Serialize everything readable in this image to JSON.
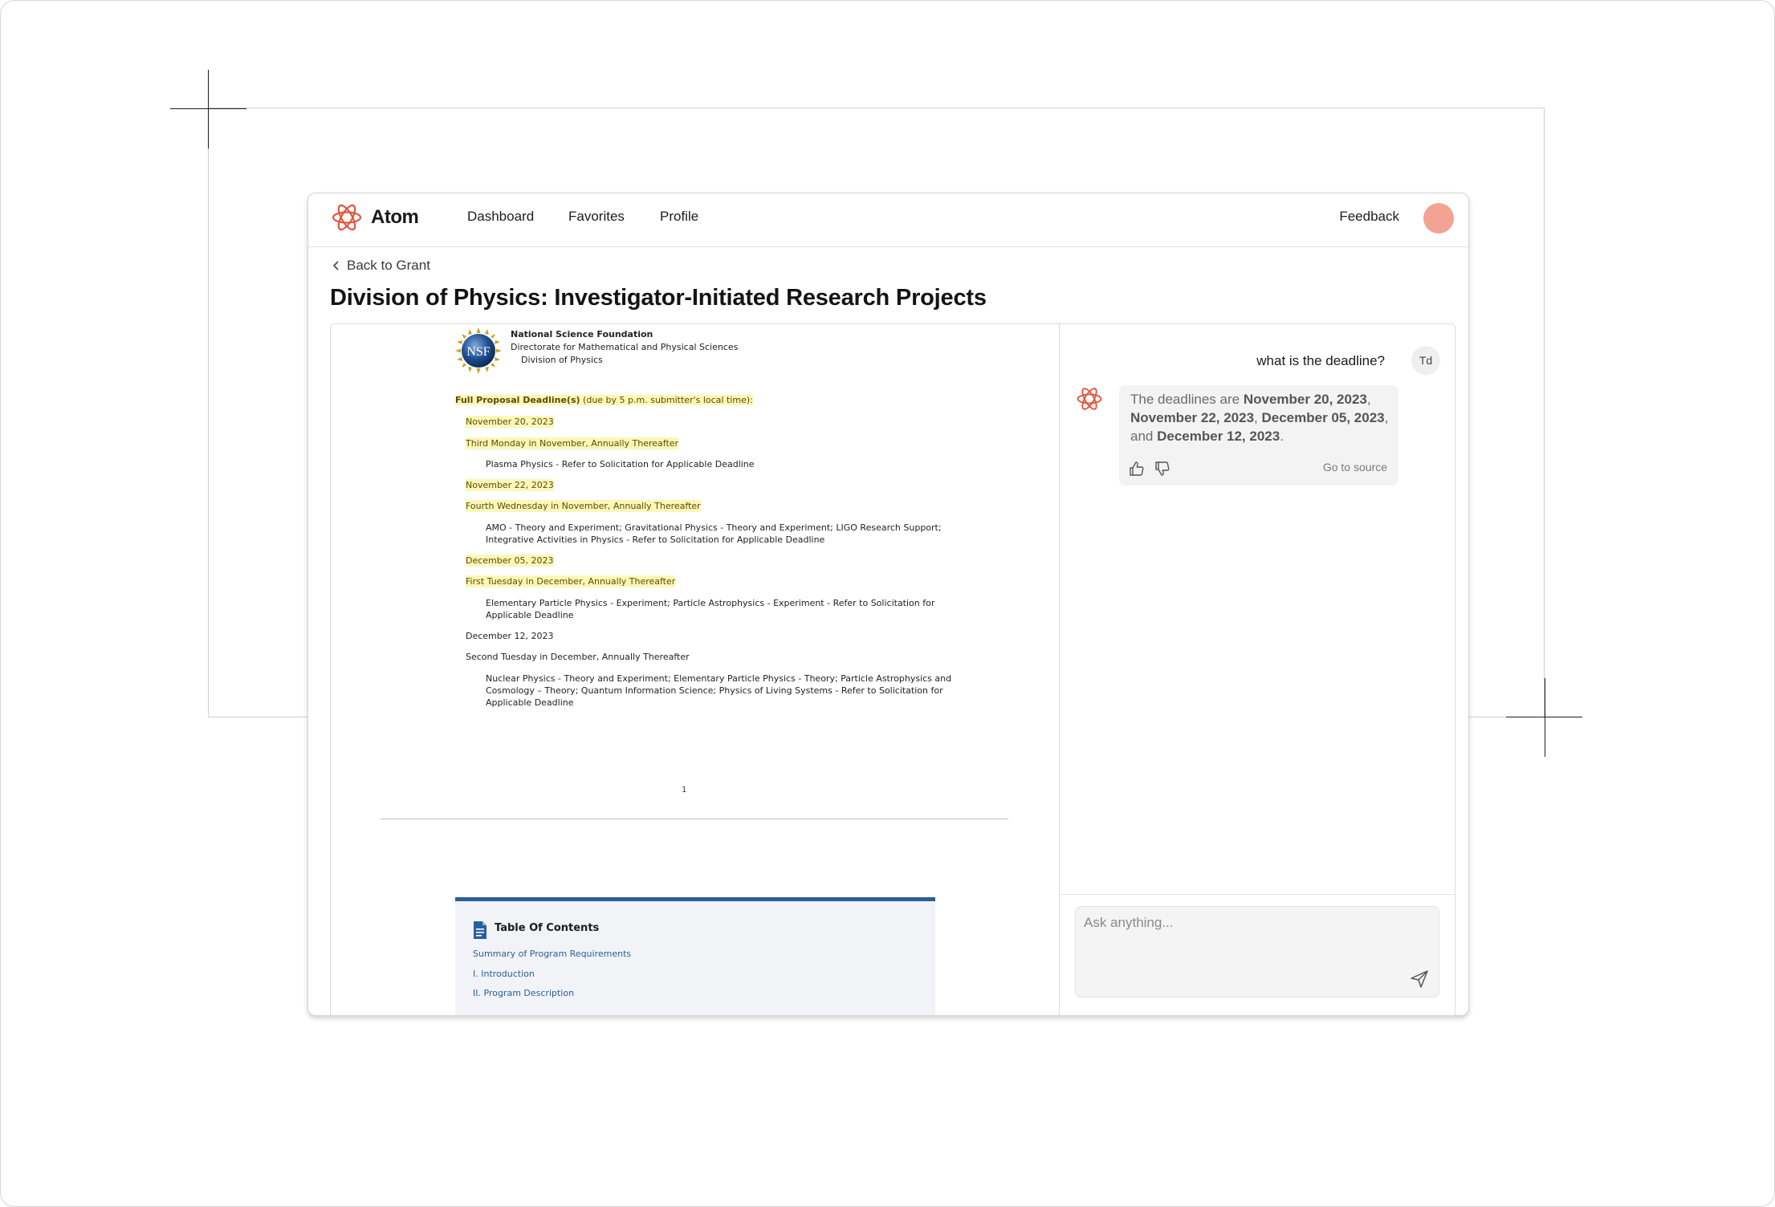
{
  "app": {
    "name": "Atom",
    "accent_color": "#e0563f"
  },
  "nav": {
    "links": [
      "Dashboard",
      "Favorites",
      "Profile"
    ],
    "feedback": "Feedback",
    "avatar_color": "#f2a393"
  },
  "breadcrumb": {
    "back": "Back to Grant"
  },
  "page": {
    "title": "Division of Physics: Investigator-Initiated Research Projects"
  },
  "document": {
    "header": {
      "org": "National Science Foundation",
      "directorate": "Directorate for Mathematical and Physical Sciences",
      "division": "Division of Physics",
      "seal_text": "NSF"
    },
    "deadline_heading": "Full Proposal Deadline(s)",
    "deadline_note": "(due by 5 p.m. submitter's local time):",
    "entries": [
      {
        "date": "November 20, 2023",
        "rule": "Third Monday in November, Annually Thereafter",
        "desc": [
          "Plasma Physics - Refer to Solicitation for Applicable Deadline"
        ]
      },
      {
        "date": "November 22, 2023",
        "rule": "Fourth Wednesday in November, Annually Thereafter",
        "desc": [
          "AMO - Theory and Experiment; Gravitational Physics - Theory and Experiment; LIGO Research Support;",
          "Integrative Activities in Physics - Refer to Solicitation for Applicable Deadline"
        ]
      },
      {
        "date": "December 05, 2023",
        "rule": "First Tuesday in December, Annually Thereafter",
        "desc": [
          "Elementary Particle Physics - Experiment; Particle Astrophysics - Experiment - Refer to Solicitation for",
          "Applicable Deadline"
        ]
      },
      {
        "date": "December 12, 2023",
        "rule": "Second Tuesday in December, Annually Thereafter",
        "desc": [
          "Nuclear Physics - Theory and Experiment; Elementary Particle Physics - Theory; Particle Astrophysics and",
          "Cosmology – Theory; Quantum Information Science; Physics of Living Systems - Refer to Solicitation for",
          "Applicable Deadline"
        ]
      }
    ],
    "page_number": "1",
    "toc": {
      "title": "Table Of Contents",
      "items": [
        {
          "num": "",
          "label": "Summary of Program Requirements"
        },
        {
          "num": "I.",
          "label": "Introduction"
        },
        {
          "num": "II.",
          "label": "Program Description"
        }
      ],
      "accent_color": "#2a5f9c"
    },
    "highlight_color": "#fbf7b8"
  },
  "chat": {
    "user_message": "what is the deadline?",
    "user_initials": "Td",
    "answer": {
      "prefix": "The deadlines are ",
      "dates": [
        "November 20, 2023",
        "November 22, 2023",
        "December 05, 2023",
        "December 12, 2023"
      ],
      "sep1": ", ",
      "sep2": ", ",
      "sep3": ", and ",
      "suffix": "."
    },
    "go_to_source": "Go to source",
    "input_placeholder": "Ask anything..."
  }
}
